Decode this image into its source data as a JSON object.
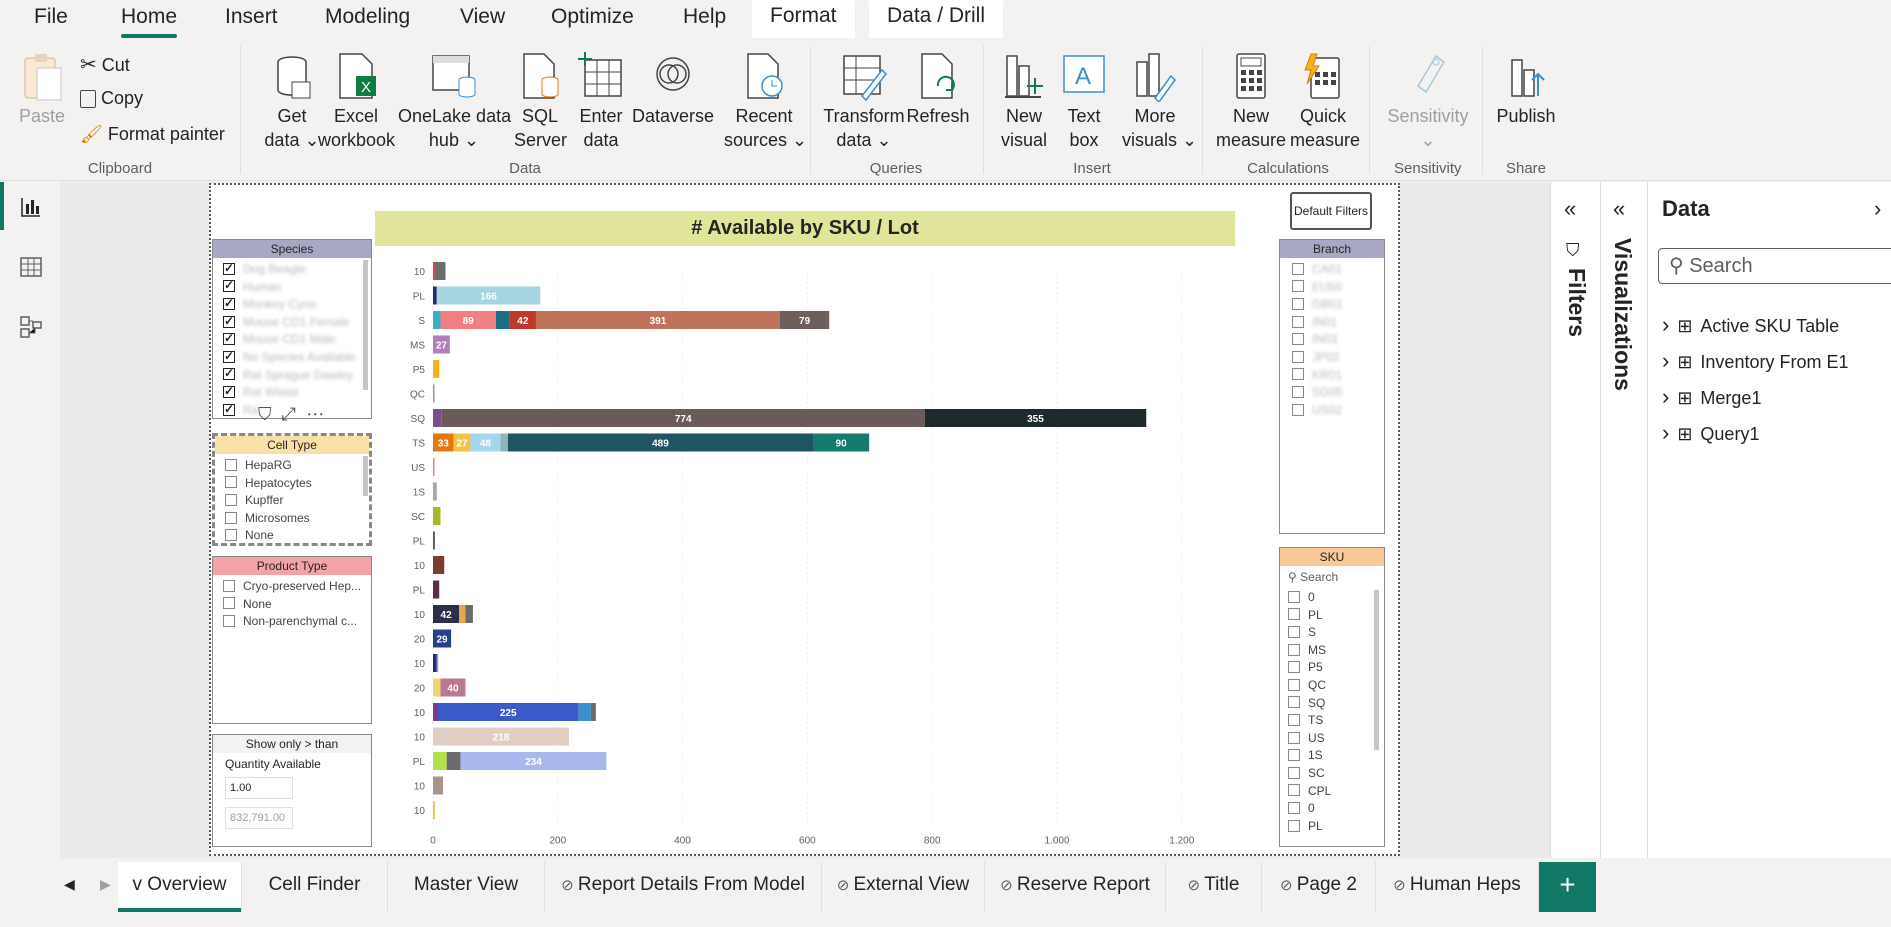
{
  "menu": {
    "items": [
      "File",
      "Home",
      "Insert",
      "Modeling",
      "View",
      "Optimize",
      "Help"
    ],
    "context_tabs": [
      "Format",
      "Data / Drill"
    ]
  },
  "ribbon": {
    "clipboard": {
      "paste": "Paste",
      "cut": "Cut",
      "copy": "Copy",
      "format_painter": "Format painter",
      "group": "Clipboard"
    },
    "data": {
      "get_data": [
        "Get",
        "data"
      ],
      "excel": [
        "Excel",
        "workbook"
      ],
      "onelake": [
        "OneLake data",
        "hub"
      ],
      "sql": [
        "SQL",
        "Server"
      ],
      "enter_data": [
        "Enter",
        "data"
      ],
      "dataverse": "Dataverse",
      "recent": [
        "Recent",
        "sources"
      ],
      "group": "Data"
    },
    "queries": {
      "transform": [
        "Transform",
        "data"
      ],
      "refresh": "Refresh",
      "group": "Queries"
    },
    "insert": {
      "new_visual": [
        "New",
        "visual"
      ],
      "text_box": [
        "Text",
        "box"
      ],
      "more_visuals": [
        "More",
        "visuals"
      ],
      "group": "Insert"
    },
    "calculations": {
      "new_measure": [
        "New",
        "measure"
      ],
      "quick_measure": [
        "Quick",
        "measure"
      ],
      "group": "Calculations"
    },
    "sensitivity": {
      "label": "Sensitivity",
      "group": "Sensitivity"
    },
    "share": {
      "publish": "Publish",
      "group": "Share"
    }
  },
  "report": {
    "title": "# Available by SKU / Lot",
    "default_filters": "Default Filters",
    "species": {
      "header": "Species",
      "items": [
        "Dog Beagle",
        "Human",
        "Monkey Cyno",
        "Mouse CD1 Female",
        "Mouse CD1 Male",
        "No Species Available",
        "Rat Sprague Dawley",
        "Rat Wistar",
        "Ra"
      ]
    },
    "cell_type": {
      "header": "Cell Type",
      "items": [
        "HepaRG",
        "Hepatocytes",
        "Kupffer",
        "Microsomes",
        "None"
      ]
    },
    "product_type": {
      "header": "Product Type",
      "items": [
        "Cryo-preserved Hep...",
        "None",
        "Non-parenchymal c..."
      ]
    },
    "show_only": {
      "header": "Show only > than",
      "label": "Quantity Available",
      "value": "1.00",
      "max": "832,791.00"
    },
    "branch": {
      "header": "Branch",
      "items": [
        "CA01",
        "EU50",
        "GB01",
        "IN01",
        "IN03",
        "JP02",
        "KR01",
        "SG05",
        "US02"
      ]
    },
    "sku": {
      "header": "SKU",
      "search": "Search",
      "items": [
        "0",
        "PL",
        "S",
        "MS",
        "P5",
        "QC",
        "SQ",
        "TS",
        "US",
        "1S",
        "SC",
        "CPL",
        "0",
        "PL"
      ]
    }
  },
  "chart_data": {
    "type": "bar",
    "orientation": "horizontal-stacked",
    "title": "# Available by SKU / Lot",
    "xlim": [
      0,
      1250
    ],
    "xticks": [
      "0",
      "200",
      "400",
      "600",
      "800",
      "1.000",
      "1.200"
    ],
    "categories": [
      "10",
      "PL",
      "S",
      "MS",
      "P5",
      "QC",
      "SQ",
      "TS",
      "US",
      "1S",
      "SC",
      "PL",
      "10",
      "PL",
      "10",
      "20",
      "10",
      "20",
      "10",
      "10",
      "PL",
      "10",
      "10"
    ],
    "rows": [
      {
        "segments": [
          {
            "v": 4,
            "c": "#d64550"
          },
          {
            "v": 16,
            "c": "#6b6b6b"
          }
        ]
      },
      {
        "segments": [
          {
            "v": 6,
            "c": "#1f2b6b"
          },
          {
            "v": 166,
            "c": "#a6d5e0",
            "label": "166"
          }
        ]
      },
      {
        "segments": [
          {
            "v": 12,
            "c": "#3ab0c8"
          },
          {
            "v": 89,
            "c": "#f08080",
            "label": "89"
          },
          {
            "v": 22,
            "c": "#1b6f85"
          },
          {
            "v": 42,
            "c": "#c0392b",
            "label": "42"
          },
          {
            "v": 391,
            "c": "#c0735a",
            "label": "391"
          },
          {
            "v": 79,
            "c": "#6e5e5e",
            "label": "79"
          }
        ]
      },
      {
        "segments": [
          {
            "v": 27,
            "c": "#b07fb8",
            "label": "27"
          }
        ]
      },
      {
        "segments": [
          {
            "v": 10,
            "c": "#f1b51c"
          }
        ]
      },
      {
        "segments": [
          {
            "v": 1,
            "c": "#999"
          }
        ]
      },
      {
        "segments": [
          {
            "v": 14,
            "c": "#7b4f8c"
          },
          {
            "v": 774,
            "c": "#6b5a5a",
            "label": "774"
          },
          {
            "v": 355,
            "c": "#1f2a2c",
            "label": "355"
          }
        ]
      },
      {
        "segments": [
          {
            "v": 33,
            "c": "#e8760f",
            "label": "33"
          },
          {
            "v": 27,
            "c": "#f3c246",
            "label": "27"
          },
          {
            "v": 48,
            "c": "#a6d5ee",
            "label": "48"
          },
          {
            "v": 12,
            "c": "#8fb7b7"
          },
          {
            "v": 489,
            "c": "#1e5561",
            "label": "489"
          },
          {
            "v": 90,
            "c": "#157a6e",
            "label": "90"
          }
        ]
      },
      {
        "segments": [
          {
            "v": 2,
            "c": "#f08080"
          }
        ]
      },
      {
        "segments": [
          {
            "v": 6,
            "c": "#a6a6a6"
          }
        ]
      },
      {
        "segments": [
          {
            "v": 12,
            "c": "#a8b820"
          }
        ]
      },
      {
        "segments": [
          {
            "v": 3,
            "c": "#555"
          }
        ]
      },
      {
        "segments": [
          {
            "v": 18,
            "c": "#7b3b2e"
          }
        ]
      },
      {
        "segments": [
          {
            "v": 10,
            "c": "#5a2f4a"
          }
        ]
      },
      {
        "segments": [
          {
            "v": 42,
            "c": "#2c2f4a",
            "label": "42"
          },
          {
            "v": 10,
            "c": "#e8a84a"
          },
          {
            "v": 12,
            "c": "#6b6b6b"
          }
        ]
      },
      {
        "segments": [
          {
            "v": 29,
            "c": "#27408b",
            "label": "29"
          }
        ]
      },
      {
        "segments": [
          {
            "v": 6,
            "c": "#1f2b6b"
          },
          {
            "v": 2,
            "c": "#8fa0b7"
          }
        ]
      },
      {
        "segments": [
          {
            "v": 12,
            "c": "#f3d46e"
          },
          {
            "v": 40,
            "c": "#b87a8e",
            "label": "40"
          }
        ]
      },
      {
        "segments": [
          {
            "v": 8,
            "c": "#7b3b8c"
          },
          {
            "v": 225,
            "c": "#3a5bc7",
            "label": "225"
          },
          {
            "v": 20,
            "c": "#3a8fd0"
          },
          {
            "v": 8,
            "c": "#6b6b6b"
          }
        ]
      },
      {
        "segments": [
          {
            "v": 218,
            "c": "#e0cfc2",
            "label": "218"
          }
        ]
      },
      {
        "segments": [
          {
            "v": 22,
            "c": "#b4e04a"
          },
          {
            "v": 22,
            "c": "#6b6b6b"
          },
          {
            "v": 234,
            "c": "#a8b8ee",
            "label": "234"
          }
        ]
      },
      {
        "segments": [
          {
            "v": 16,
            "c": "#a6958e"
          }
        ]
      },
      {
        "segments": [
          {
            "v": 3,
            "c": "#f3c246"
          }
        ]
      }
    ]
  },
  "panes": {
    "filters": "Filters",
    "visualizations": "Visualizations",
    "data": {
      "title": "Data",
      "search": "Search",
      "tables": [
        "Active SKU Table",
        "Inventory From E1",
        "Merge1",
        "Query1"
      ]
    }
  },
  "tabs": {
    "items": [
      {
        "label": "v Overview",
        "hidden": false,
        "active": true
      },
      {
        "label": "Cell Finder",
        "hidden": false
      },
      {
        "label": "Master View",
        "hidden": false
      },
      {
        "label": "Report Details From Model",
        "hidden": true
      },
      {
        "label": "External View",
        "hidden": true
      },
      {
        "label": "Reserve Report",
        "hidden": true
      },
      {
        "label": "Title",
        "hidden": true
      },
      {
        "label": "Page 2",
        "hidden": true
      },
      {
        "label": "Human Heps",
        "hidden": true
      }
    ],
    "add": "+"
  }
}
